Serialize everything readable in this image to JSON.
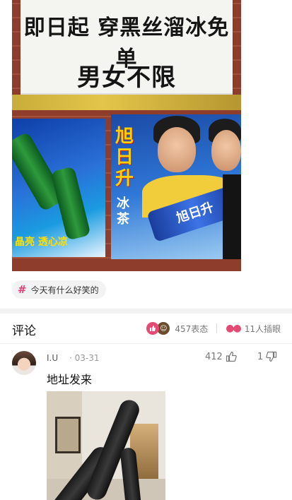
{
  "post": {
    "sign_line1": "即日起 穿黑丝溜冰免单",
    "sign_line2": "男女不限",
    "poster_left_text": "晶亮 透心凉",
    "poster_right_brand": "旭日升",
    "poster_right_sub": "冰茶",
    "poster_can_text": "旭日升"
  },
  "tag": {
    "label": "今天有什么好笑的"
  },
  "comments_header": {
    "title": "评论",
    "reactions_count": "457表态",
    "watchers_count": "11人插眼"
  },
  "comment": {
    "username": "I.U",
    "date": "· 03-31",
    "likes": "412",
    "dislikes": "1",
    "text": "地址发来"
  },
  "colors": {
    "accent_pink": "#e34a74",
    "tag_bg": "#f3f3f3"
  },
  "icons": [
    "hash-icon",
    "thumbs-up-icon",
    "emoji-icon",
    "eyes-icon",
    "thumbs-down-icon"
  ]
}
